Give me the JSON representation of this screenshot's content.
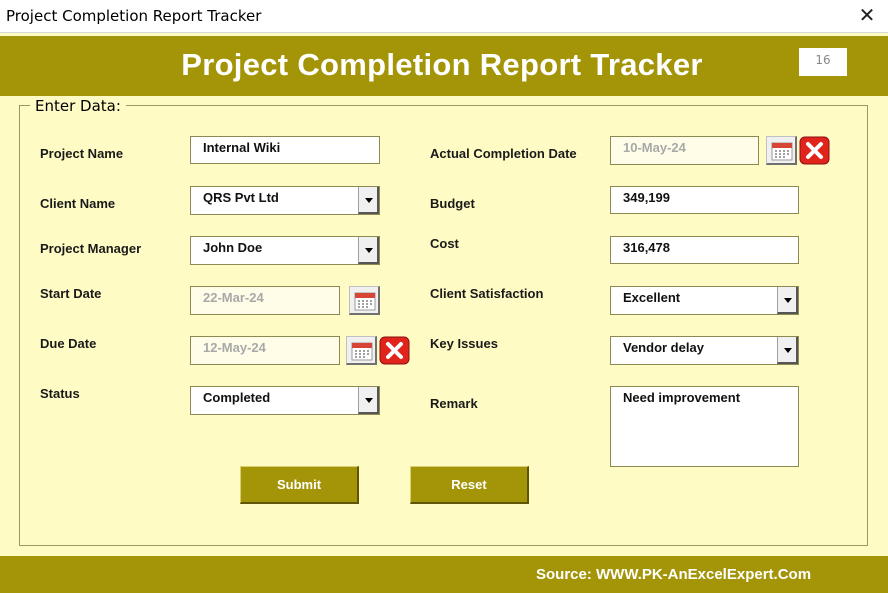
{
  "window": {
    "title": "Project Completion Report Tracker",
    "close_glyph": "✕"
  },
  "header": {
    "title": "Project Completion Report Tracker",
    "record_number": "16"
  },
  "frame_label": "Enter Data:",
  "fields": {
    "project_name": {
      "label": "Project Name",
      "value": "Internal Wiki"
    },
    "client_name": {
      "label": "Client Name",
      "value": "QRS Pvt Ltd"
    },
    "project_manager": {
      "label": "Project Manager",
      "value": "John Doe"
    },
    "start_date": {
      "label": "Start Date",
      "value": "22-Mar-24"
    },
    "due_date": {
      "label": "Due Date",
      "value": "12-May-24"
    },
    "status": {
      "label": "Status",
      "value": "Completed"
    },
    "actual_completion_date": {
      "label": "Actual Completion Date",
      "value": "10-May-24"
    },
    "budget": {
      "label": "Budget",
      "value": "349,199"
    },
    "cost": {
      "label": "Cost",
      "value": "316,478"
    },
    "client_satisfaction": {
      "label": "Client Satisfaction",
      "value": "Excellent"
    },
    "key_issues": {
      "label": "Key Issues",
      "value": "Vendor delay"
    },
    "remark": {
      "label": "Remark",
      "value": "Need improvement"
    }
  },
  "buttons": {
    "submit": "Submit",
    "reset": "Reset"
  },
  "footer": {
    "source": "Source: WWW.PK-AnExcelExpert.Com"
  },
  "colors": {
    "accent": "#A39507",
    "background": "#FFFBC4",
    "clear_red": "#E0241B"
  },
  "icons": {
    "calendar": "calendar-icon",
    "clear": "clear-x-icon",
    "dropdown": "chevron-down-icon"
  }
}
